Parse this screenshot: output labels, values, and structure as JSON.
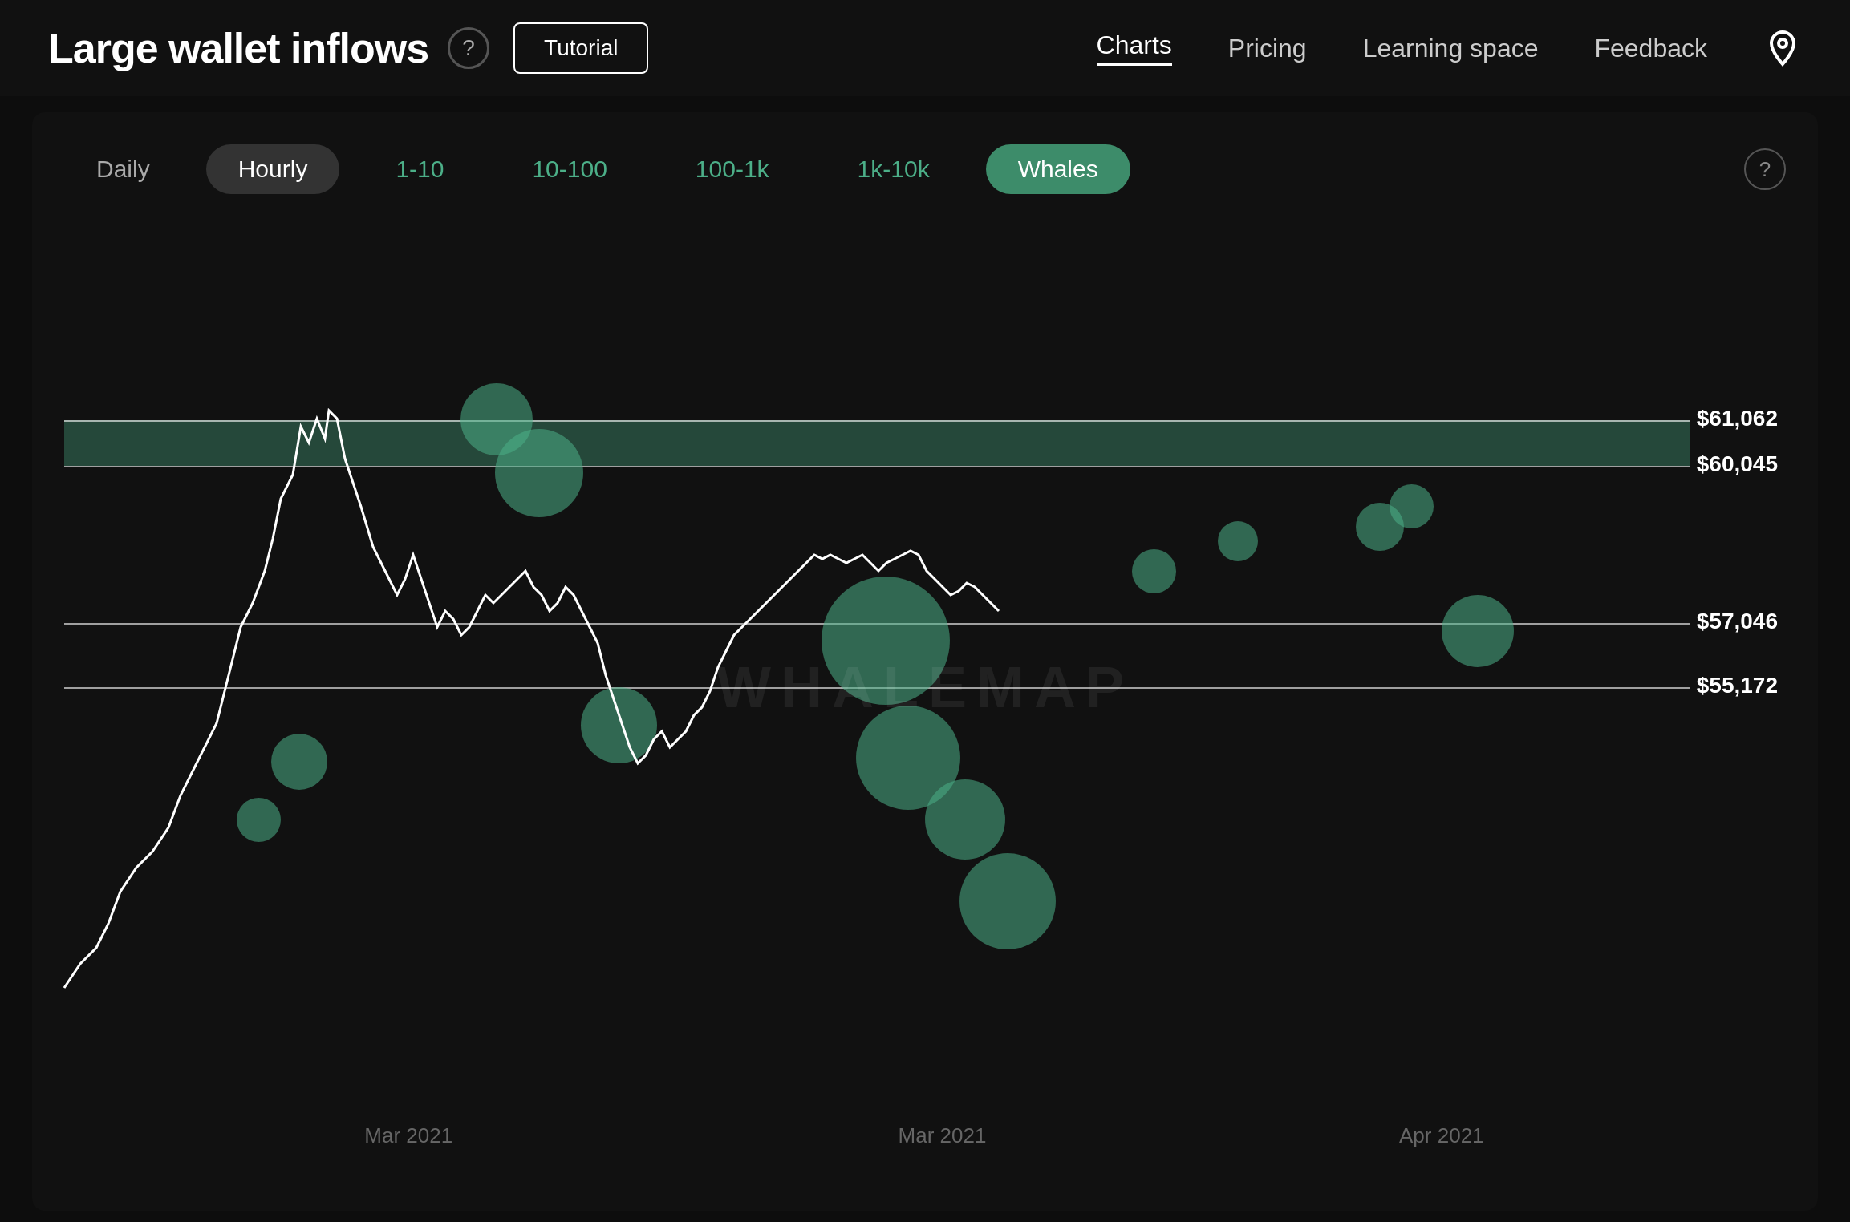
{
  "header": {
    "title": "Large wallet inflows",
    "help_icon": "?",
    "tutorial_btn": "Tutorial",
    "nav": [
      {
        "label": "Charts",
        "active": true
      },
      {
        "label": "Pricing",
        "active": false
      },
      {
        "label": "Learning space",
        "active": false
      },
      {
        "label": "Feedback",
        "active": false
      }
    ]
  },
  "filters": {
    "time": [
      {
        "label": "Daily",
        "state": "normal"
      },
      {
        "label": "Hourly",
        "state": "selected-dark"
      }
    ],
    "size": [
      {
        "label": "1-10",
        "state": "green-text"
      },
      {
        "label": "10-100",
        "state": "green-text"
      },
      {
        "label": "100-1k",
        "state": "green-text"
      },
      {
        "label": "1k-10k",
        "state": "green-text"
      },
      {
        "label": "Whales",
        "state": "selected-green"
      }
    ]
  },
  "chart": {
    "watermark": "WHALEMAP",
    "price_levels": [
      {
        "value": "$61,062",
        "y_pct": 22
      },
      {
        "value": "$60,045",
        "y_pct": 26
      },
      {
        "value": "$57,046",
        "y_pct": 43
      },
      {
        "value": "$55,172",
        "y_pct": 50
      }
    ],
    "x_labels": [
      {
        "label": "Mar 2021",
        "x_pct": 20
      },
      {
        "label": "Mar 2021",
        "x_pct": 51
      },
      {
        "label": "Apr 2021",
        "x_pct": 80
      }
    ]
  }
}
